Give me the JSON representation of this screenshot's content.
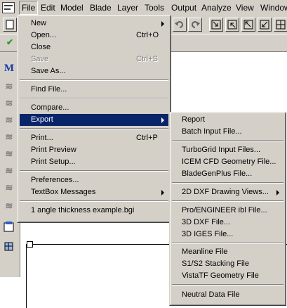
{
  "menubar": {
    "items": [
      "File",
      "Edit",
      "Model",
      "Blade",
      "Layer",
      "Tools",
      "Output",
      "Analyze",
      "View",
      "Window"
    ]
  },
  "file_menu": {
    "items": [
      {
        "label": "New",
        "shortcut": "",
        "submenu": true,
        "disabled": false
      },
      {
        "label": "Open...",
        "shortcut": "Ctrl+O",
        "submenu": false,
        "disabled": false
      },
      {
        "label": "Close",
        "shortcut": "",
        "submenu": false,
        "disabled": false
      },
      {
        "label": "Save",
        "shortcut": "Ctrl+S",
        "submenu": false,
        "disabled": true
      },
      {
        "label": "Save As...",
        "shortcut": "",
        "submenu": false,
        "disabled": false
      },
      {
        "label": "Find File...",
        "shortcut": "",
        "submenu": false,
        "disabled": false
      },
      {
        "label": "Compare...",
        "shortcut": "",
        "submenu": false,
        "disabled": false
      },
      {
        "label": "Export",
        "shortcut": "",
        "submenu": true,
        "disabled": false,
        "highlighted": true
      },
      {
        "label": "Print...",
        "shortcut": "Ctrl+P",
        "submenu": false,
        "disabled": false
      },
      {
        "label": "Print Preview",
        "shortcut": "",
        "submenu": false,
        "disabled": false
      },
      {
        "label": "Print Setup...",
        "shortcut": "",
        "submenu": false,
        "disabled": false
      },
      {
        "label": "Preferences...",
        "shortcut": "",
        "submenu": false,
        "disabled": false
      },
      {
        "label": "TextBox Messages",
        "shortcut": "",
        "submenu": true,
        "disabled": false
      },
      {
        "label": "1 angle thickness example.bgi",
        "shortcut": "",
        "submenu": false,
        "disabled": false
      }
    ]
  },
  "export_menu": {
    "items": [
      {
        "label": "Report",
        "submenu": false
      },
      {
        "label": "Batch Input File...",
        "submenu": false
      },
      {
        "label": "TurboGrid Input Files...",
        "submenu": false
      },
      {
        "label": "ICEM CFD Geometry File...",
        "submenu": false
      },
      {
        "label": "BladeGenPlus File...",
        "submenu": false
      },
      {
        "label": "2D DXF Drawing Views...",
        "submenu": true
      },
      {
        "label": "Pro/ENGINEER ibl File...",
        "submenu": false
      },
      {
        "label": "3D DXF File...",
        "submenu": false
      },
      {
        "label": "3D IGES File...",
        "submenu": false
      },
      {
        "label": "Meanline File",
        "submenu": false
      },
      {
        "label": "S1/S2 Stacking File",
        "submenu": false
      },
      {
        "label": "VistaTF Geometry File",
        "submenu": false
      },
      {
        "label": "Neutral Data File",
        "submenu": false
      }
    ]
  },
  "toolbar": {
    "icons": [
      "undo-icon",
      "redo-icon",
      "view-fit-icon",
      "view-zoom-icon",
      "view-pan-icon",
      "view-rotate-icon",
      "view-grid-icon"
    ]
  },
  "left_toolbar": {
    "icons": [
      "model-icon",
      "layer-icon",
      "blade-icon",
      "blade-view-icon",
      "angle-icon",
      "thickness-icon",
      "stack-icon",
      "section-icon",
      "crosshair-icon",
      "mesh-icon",
      "notes-icon",
      "grid-3d-icon"
    ]
  },
  "colors": {
    "face": "#d4d0c8",
    "highlight": "#0a246a",
    "disabled": "#808080"
  }
}
